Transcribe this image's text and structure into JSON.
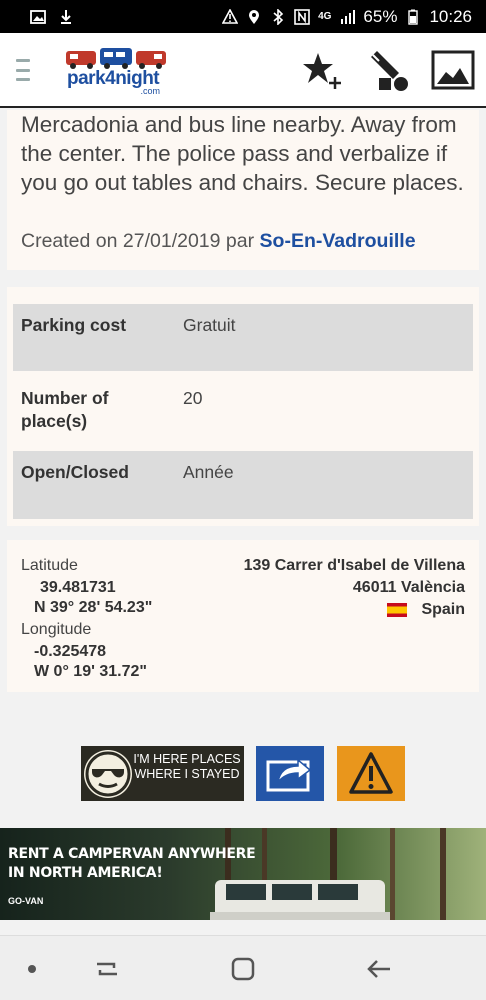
{
  "status_bar": {
    "battery": "65%",
    "time": "10:26",
    "network": "4G",
    "icons": [
      "image-icon",
      "download-icon",
      "warning-icon",
      "location-icon",
      "bluetooth-icon",
      "nfc-icon",
      "signal-icon",
      "battery-icon"
    ]
  },
  "app_bar": {
    "logo_text": "park4night",
    "logo_suffix": ".com",
    "icons": [
      "menu-icon",
      "add-favorite-icon",
      "edit-icon",
      "photo-icon"
    ]
  },
  "description": {
    "text": "Mercadonia and bus line nearby. Away from the center. The police pass and verbalize if you go out tables and chairs. Secure places.",
    "created_prefix": "Created on 27/01/2019 par",
    "author": "So-En-Vadrouille"
  },
  "info": [
    {
      "label": "Parking cost",
      "value": "Gratuit"
    },
    {
      "label": "Number of place(s)",
      "value": "20"
    },
    {
      "label": "Open/Closed",
      "value": "Année"
    }
  ],
  "location": {
    "latitude_label": "Latitude",
    "latitude_dec": "39.481731",
    "latitude_dms": "N 39° 28' 54.23\"",
    "longitude_label": "Longitude",
    "longitude_dec": "-0.325478",
    "longitude_dms": "W 0° 19' 31.72\"",
    "address_line1": "139 Carrer d'Isabel de Villena",
    "address_line2": "46011 València",
    "country": "Spain"
  },
  "actions": {
    "here_label": "I'M HERE PLACES WHERE I STAYED"
  },
  "ad": {
    "line1": "RENT A CAMPERVAN ANYWHERE",
    "line2": "IN NORTH AMERICA!",
    "brand": "GO-VAN"
  },
  "colors": {
    "brand_blue": "#1e4fa0",
    "card_bg": "#fdf8f3",
    "share_blue": "#2456a8",
    "warning_orange": "#e9961c"
  }
}
